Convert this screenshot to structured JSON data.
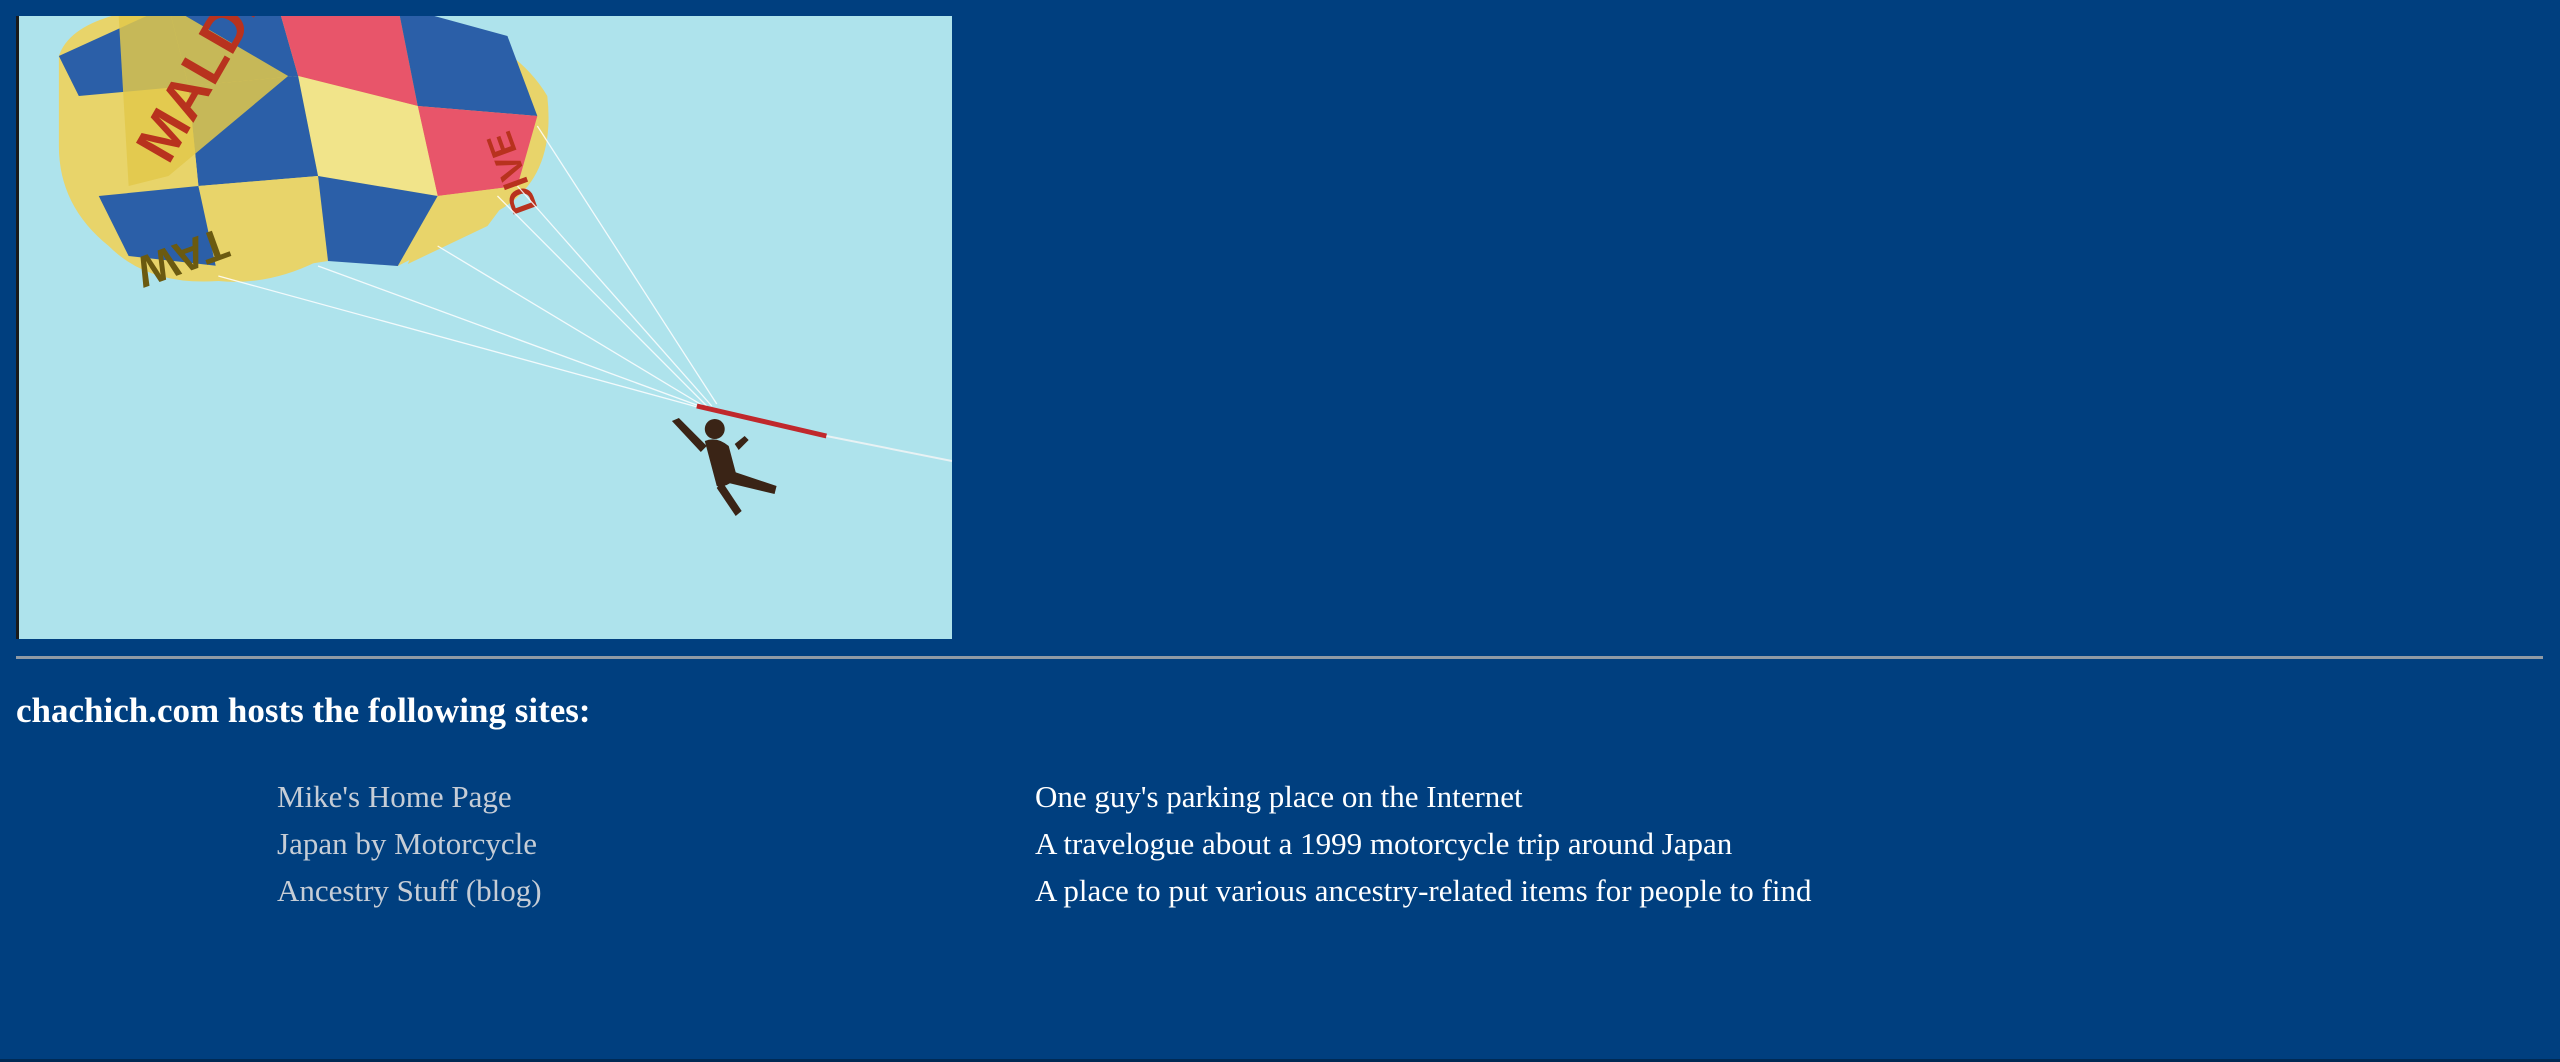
{
  "hero_image": {
    "subject": "parasail-photo",
    "canopy_lettering": "MALDIVES"
  },
  "heading": "chachich.com hosts the following sites:",
  "sites": [
    {
      "name": "Mike's Home Page",
      "description": "One guy's parking place on the Internet"
    },
    {
      "name": "Japan by Motorcycle",
      "description": "A travelogue about a 1999 motorcycle trip around Japan"
    },
    {
      "name": "Ancestry Stuff (blog)",
      "description": "A place to put various ancestry-related items for people to find"
    }
  ],
  "colors": {
    "background": "#003f7f",
    "link": "#c6cdd6",
    "text": "#ffffff",
    "sky": "#aee3ec"
  }
}
